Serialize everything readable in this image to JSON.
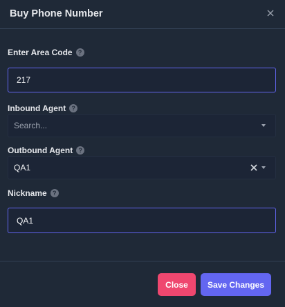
{
  "dialog": {
    "title": "Buy Phone Number",
    "close_icon": "close-icon"
  },
  "area_code": {
    "label": "Enter Area Code",
    "value": "217",
    "help_icon": "help-icon"
  },
  "inbound_agent": {
    "label": "Inbound Agent",
    "placeholder": "Search...",
    "help_icon": "help-icon"
  },
  "outbound_agent": {
    "label": "Outbound Agent",
    "value": "QA1",
    "help_icon": "help-icon"
  },
  "nickname": {
    "label": "Nickname",
    "value": "QA1",
    "help_icon": "help-icon"
  },
  "footer": {
    "close_label": "Close",
    "save_label": "Save Changes"
  },
  "colors": {
    "background": "#1f2937",
    "focus_border": "#6366f1",
    "close_button": "#ef476f",
    "save_button": "#6366f1"
  }
}
